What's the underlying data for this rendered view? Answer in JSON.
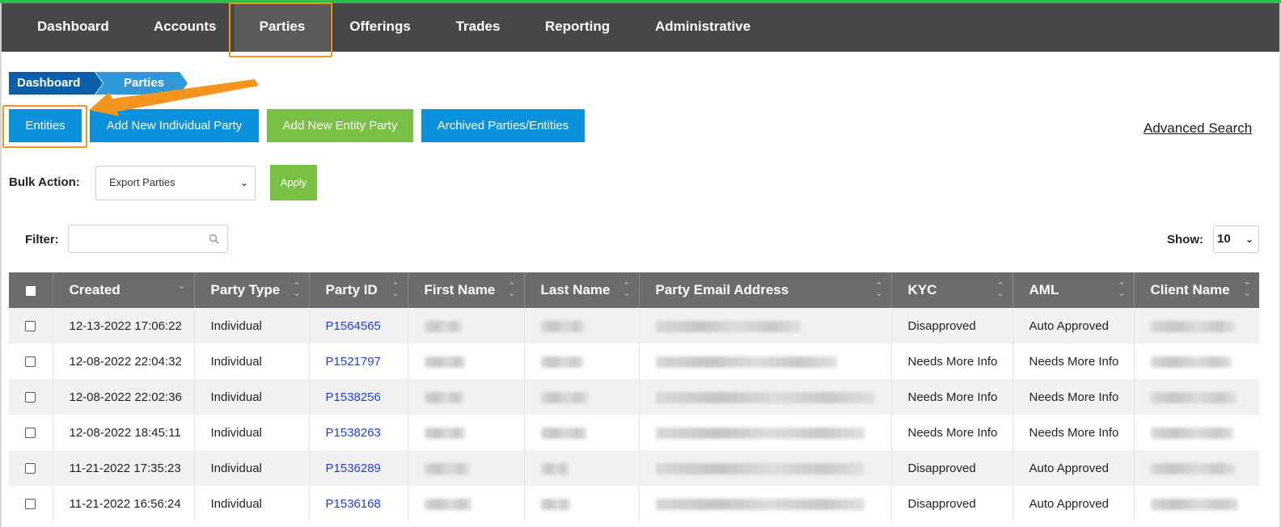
{
  "nav": {
    "items": [
      "Dashboard",
      "Accounts",
      "Parties",
      "Offerings",
      "Trades",
      "Reporting",
      "Administrative"
    ],
    "active": "Parties"
  },
  "breadcrumb": [
    "Dashboard",
    "Parties"
  ],
  "actions": {
    "entities": "Entities",
    "add_individual": "Add New Individual Party",
    "add_entity": "Add New Entity Party",
    "archived": "Archived Parties/Entities",
    "advanced_search": "Advanced Search"
  },
  "bulk": {
    "label": "Bulk Action:",
    "selected": "Export Parties",
    "apply": "Apply"
  },
  "filter": {
    "label": "Filter:",
    "value": ""
  },
  "show": {
    "label": "Show:",
    "value": "10"
  },
  "table": {
    "columns": [
      "Created",
      "Party Type",
      "Party ID",
      "First Name",
      "Last Name",
      "Party Email Address",
      "KYC",
      "AML",
      "Client Name"
    ],
    "rows": [
      {
        "created": "12-13-2022 17:06:22",
        "type": "Individual",
        "id": "P1564565",
        "kyc": "Disapproved",
        "aml": "Auto Approved"
      },
      {
        "created": "12-08-2022 22:04:32",
        "type": "Individual",
        "id": "P1521797",
        "kyc": "Needs More Info",
        "aml": "Needs More Info"
      },
      {
        "created": "12-08-2022 22:02:36",
        "type": "Individual",
        "id": "P1538256",
        "kyc": "Needs More Info",
        "aml": "Needs More Info"
      },
      {
        "created": "12-08-2022 18:45:11",
        "type": "Individual",
        "id": "P1538263",
        "kyc": "Needs More Info",
        "aml": "Needs More Info"
      },
      {
        "created": "11-21-2022 17:35:23",
        "type": "Individual",
        "id": "P1536289",
        "kyc": "Disapproved",
        "aml": "Auto Approved"
      },
      {
        "created": "11-21-2022 16:56:24",
        "type": "Individual",
        "id": "P1536168",
        "kyc": "Disapproved",
        "aml": "Auto Approved"
      }
    ]
  },
  "colors": {
    "nav_bg": "#474747",
    "accent_blue": "#0c92dc",
    "accent_green": "#79c045",
    "highlight_orange": "#f3951f",
    "link": "#1f3fd6"
  }
}
